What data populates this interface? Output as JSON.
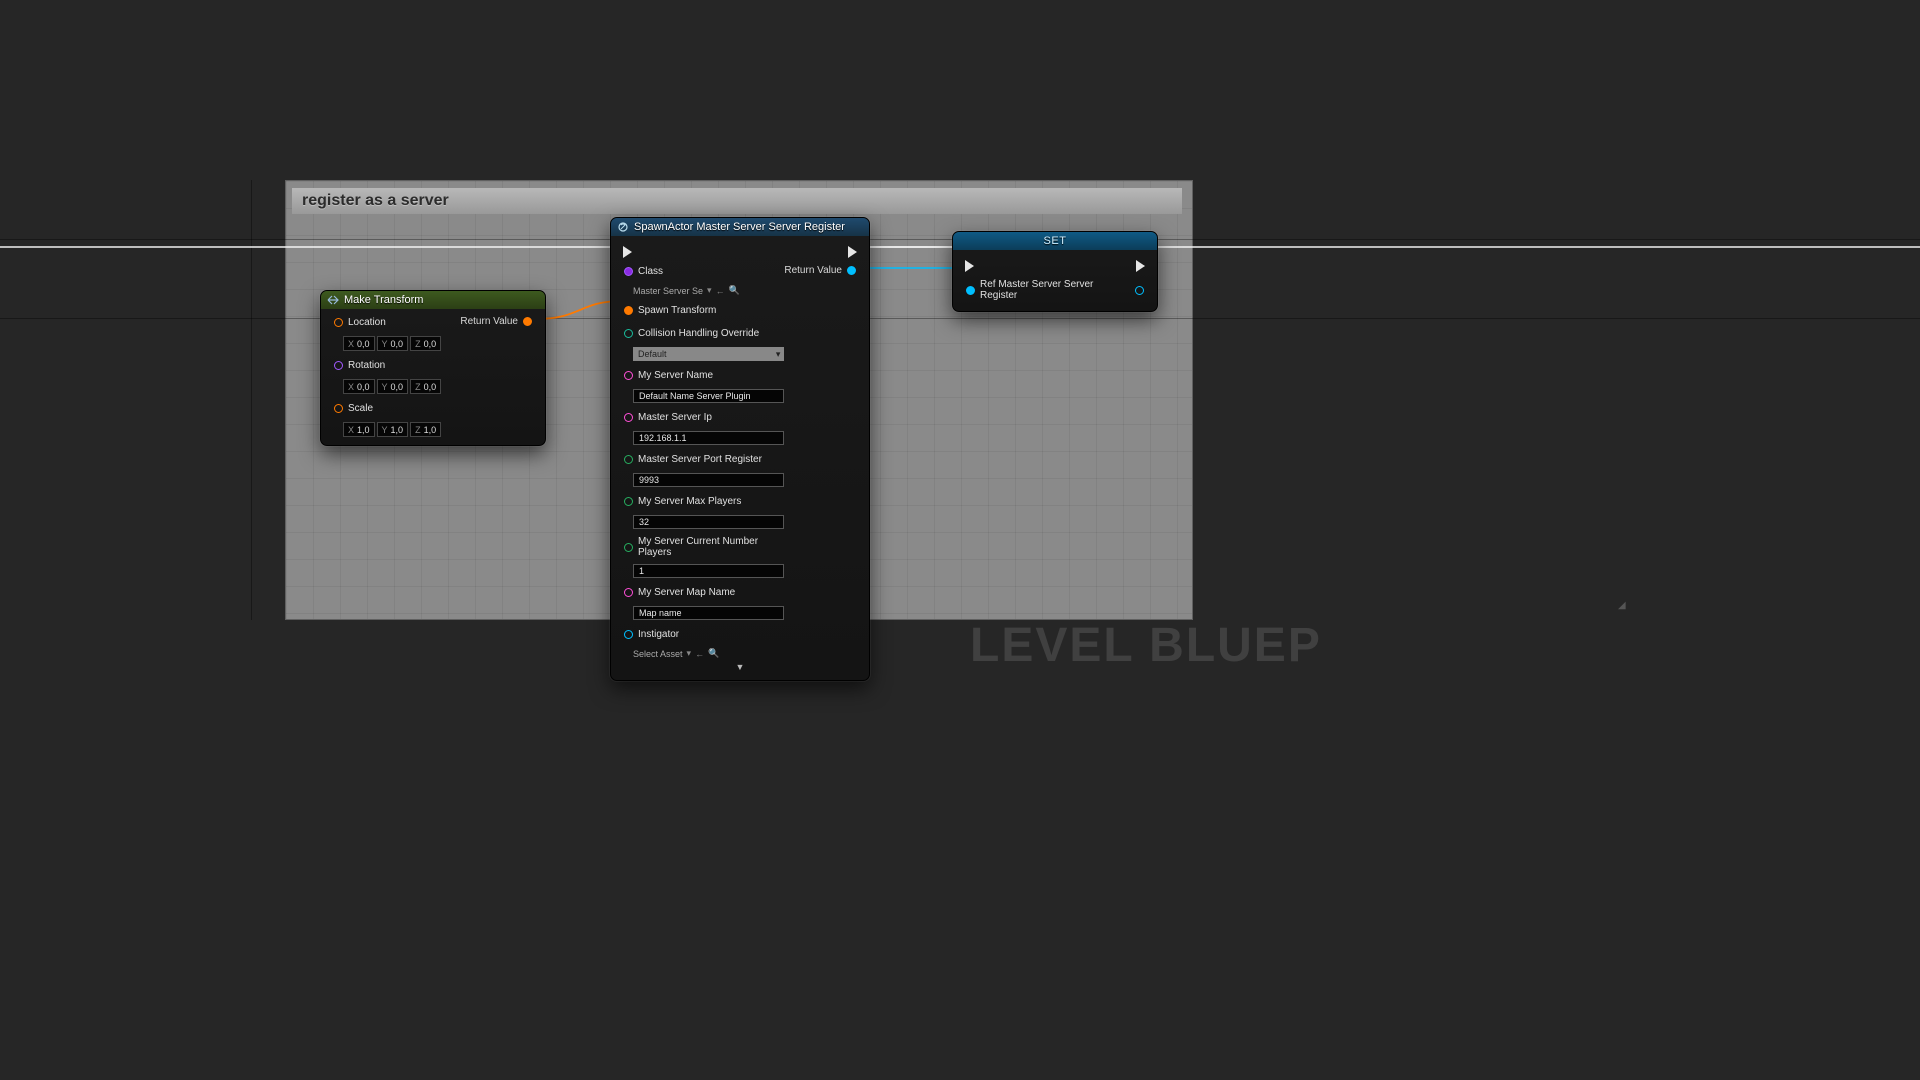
{
  "comment": {
    "title": "register as a server"
  },
  "watermark": "LEVEL BLUEP",
  "make_transform": {
    "title": "Make Transform",
    "location_label": "Location",
    "rotation_label": "Rotation",
    "scale_label": "Scale",
    "return_label": "Return Value",
    "vec_zero": {
      "x": "0,0",
      "y": "0,0",
      "z": "0,0"
    },
    "vec_one": {
      "x": "1,0",
      "y": "1,0",
      "z": "1,0"
    },
    "axis": {
      "x": "X",
      "y": "Y",
      "z": "Z"
    }
  },
  "spawn_actor": {
    "title": "SpawnActor Master Server Server Register",
    "class_label": "Class",
    "class_value": "Master Server Se",
    "spawn_transform_label": "Spawn Transform",
    "collision_label": "Collision Handling Override",
    "collision_value": "Default",
    "server_name_label": "My Server Name",
    "server_name_value": "Default Name Server Plugin",
    "master_ip_label": "Master Server Ip",
    "master_ip_value": "192.168.1.1",
    "port_label": "Master Server Port Register",
    "port_value": "9993",
    "max_players_label": "My Server Max Players",
    "max_players_value": "32",
    "cur_players_label": "My Server Current Number Players",
    "cur_players_value": "1",
    "map_label": "My Server Map Name",
    "map_value": "Map name",
    "instigator_label": "Instigator",
    "instigator_value": "Select Asset",
    "return_label": "Return Value"
  },
  "set_node": {
    "title": "SET",
    "ref_label": "Ref Master Server Server Register"
  }
}
